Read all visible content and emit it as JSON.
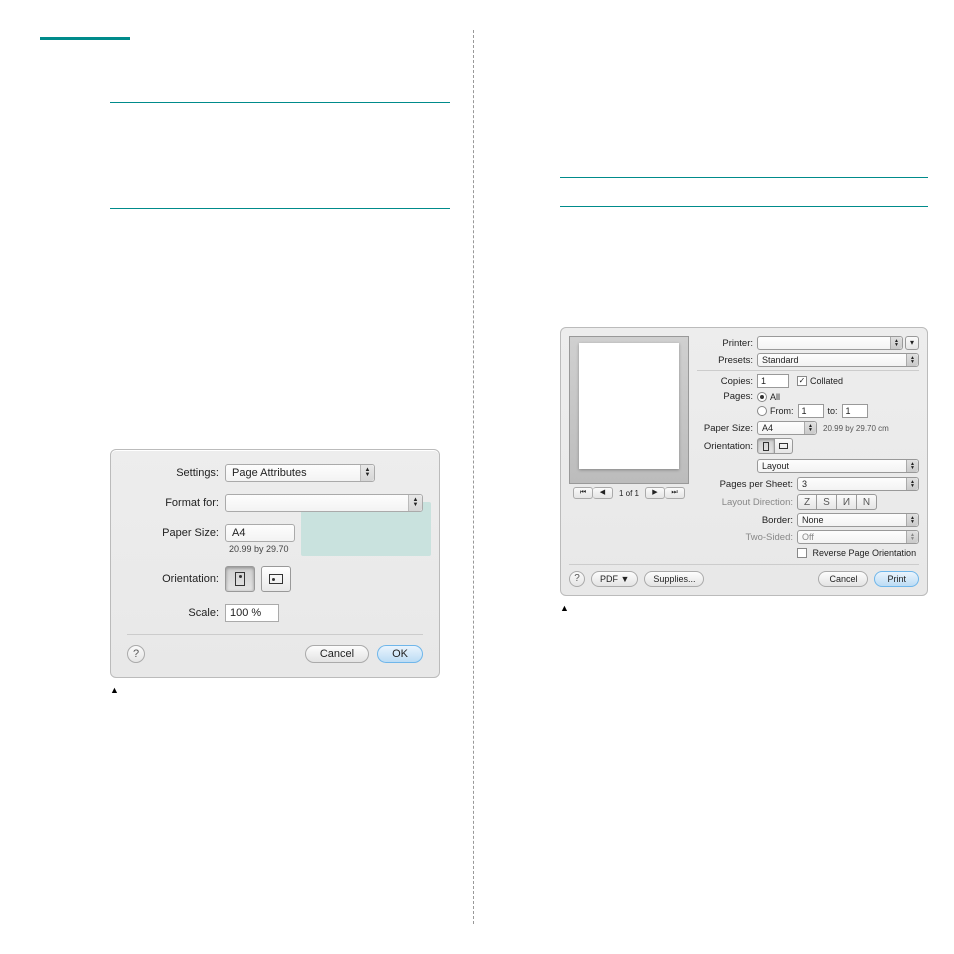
{
  "leftTealBarWidth": 90,
  "pageSetup": {
    "settingsLabel": "Settings:",
    "settingsValue": "Page Attributes",
    "formatForLabel": "Format for:",
    "formatForValue": "",
    "paperSizeLabel": "Paper Size:",
    "paperSizeValue": "A4",
    "paperDims": "20.99 by 29.70",
    "orientationLabel": "Orientation:",
    "scaleLabel": "Scale:",
    "scaleValue": "100 %",
    "cancel": "Cancel",
    "ok": "OK",
    "help": "?"
  },
  "printDialog": {
    "printerLabel": "Printer:",
    "printerValue": "",
    "presetsLabel": "Presets:",
    "presetsValue": "Standard",
    "copiesLabel": "Copies:",
    "copiesValue": "1",
    "collatedLabel": "Collated",
    "pagesLabel": "Pages:",
    "allLabel": "All",
    "fromLabel": "From:",
    "fromValue": "1",
    "toLabel": "to:",
    "toValue": "1",
    "paperSizeLabel": "Paper Size:",
    "paperSizeValue": "A4",
    "paperDims": "20.99 by 29.70 cm",
    "orientationLabel": "Orientation:",
    "sectionValue": "Layout",
    "ppsLabel": "Pages per Sheet:",
    "ppsValue": "3",
    "layoutDirLabel": "Layout Direction:",
    "dirIcons": [
      "Z",
      "S",
      "И",
      "N"
    ],
    "borderLabel": "Border:",
    "borderValue": "None",
    "twoSidedLabel": "Two-Sided:",
    "twoSidedValue": "Off",
    "reverseLabel": "Reverse Page Orientation",
    "pageIndicator": "1 of 1",
    "helpBtn": "?",
    "pdfBtn": "PDF ▼",
    "suppliesBtn": "Supplies...",
    "cancelBtn": "Cancel",
    "printBtn": "Print"
  }
}
